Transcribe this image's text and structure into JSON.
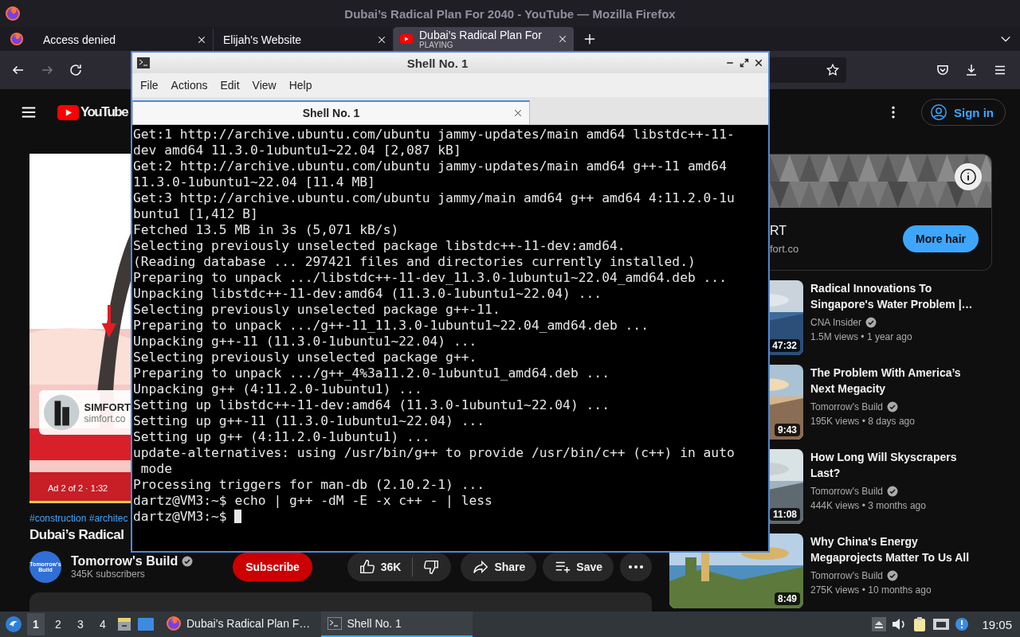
{
  "browser": {
    "title": "Dubai’s Radical Plan For 2040 - YouTube — Mozilla Firefox",
    "tabs": [
      {
        "label": "Access denied",
        "selected": false
      },
      {
        "label": "Elijah's Website",
        "selected": false
      },
      {
        "label": "Dubai’s Radical Plan For",
        "sublabel": "PLAYING",
        "selected": true
      }
    ]
  },
  "page": {
    "header": {
      "logo": "YouTube",
      "sign_in": "Sign in"
    },
    "player": {
      "kind": "picture",
      "ad_card": {
        "name": "SIMFORT",
        "url": "simfort.co"
      },
      "ad_info": "Ad 2 of 2 · 1:32"
    },
    "hashtags": "#construction #architec",
    "title": "Dubai’s Radical",
    "channel": {
      "avatar_text": "Tomorrow's Build",
      "name": "Tomorrow's Build",
      "subscribers": "345K subscribers"
    },
    "subscribe": "Subscribe",
    "likes": "36K",
    "share": "Share",
    "save": "Save"
  },
  "sidebar": {
    "ad": {
      "name": "RT",
      "url": "fort.co",
      "button": "More hair"
    },
    "videos": [
      {
        "title": "Radical Innovations To Singapore's Water Problem |…",
        "channel": "CNA Insider",
        "meta": "1.5M views • 1 year ago",
        "duration": "47:32"
      },
      {
        "title": "The Problem With America’s Next Megacity",
        "channel": "Tomorrow's Build",
        "meta": "195K views • 8 days ago",
        "duration": "9:43"
      },
      {
        "title": "How Long Will Skyscrapers Last?",
        "channel": "Tomorrow's Build",
        "meta": "444K views • 3 months ago",
        "duration": "11:08"
      },
      {
        "title": "Why China's Energy Megaprojects Matter To Us All",
        "channel": "Tomorrow's Build",
        "meta": "275K views • 10 months ago",
        "duration": "8:49"
      }
    ]
  },
  "terminal": {
    "title": "Shell No. 1",
    "menu": [
      "File",
      "Actions",
      "Edit",
      "View",
      "Help"
    ],
    "tabs": [
      {
        "label": "Shell No. 1",
        "selected": true
      }
    ],
    "lines": [
      "Get:1 http://archive.ubuntu.com/ubuntu jammy-updates/main amd64 libstdc++-11-",
      "dev amd64 11.3.0-1ubuntu1~22.04 [2,087 kB]",
      "Get:2 http://archive.ubuntu.com/ubuntu jammy-updates/main amd64 g++-11 amd64",
      "11.3.0-1ubuntu1~22.04 [11.4 MB]",
      "Get:3 http://archive.ubuntu.com/ubuntu jammy/main amd64 g++ amd64 4:11.2.0-1u",
      "buntu1 [1,412 B]",
      "Fetched 13.5 MB in 3s (5,071 kB/s)",
      "Selecting previously unselected package libstdc++-11-dev:amd64.",
      "(Reading database ... 297421 files and directories currently installed.)",
      "Preparing to unpack .../libstdc++-11-dev_11.3.0-1ubuntu1~22.04_amd64.deb ...",
      "Unpacking libstdc++-11-dev:amd64 (11.3.0-1ubuntu1~22.04) ...",
      "Selecting previously unselected package g++-11.",
      "Preparing to unpack .../g++-11_11.3.0-1ubuntu1~22.04_amd64.deb ...",
      "Unpacking g++-11 (11.3.0-1ubuntu1~22.04) ...",
      "Selecting previously unselected package g++.",
      "Preparing to unpack .../g++_4%3a11.2.0-1ubuntu1_amd64.deb ...",
      "Unpacking g++ (4:11.2.0-1ubuntu1) ...",
      "Setting up libstdc++-11-dev:amd64 (11.3.0-1ubuntu1~22.04) ...",
      "Setting up g++-11 (11.3.0-1ubuntu1~22.04) ...",
      "Setting up g++ (4:11.2.0-1ubuntu1) ...",
      "update-alternatives: using /usr/bin/g++ to provide /usr/bin/c++ (c++) in auto",
      " mode",
      "Processing triggers for man-db (2.10.2-1) ...",
      "dartz@VM3:~$ echo | g++ -dM -E -x c++ - | less",
      "dartz@VM3:~$ "
    ]
  },
  "taskbar": {
    "workspaces": [
      {
        "label": "1",
        "selected": true
      },
      {
        "label": "2",
        "selected": false
      },
      {
        "label": "3",
        "selected": false
      },
      {
        "label": "4",
        "selected": false
      }
    ],
    "tasks": [
      {
        "kind": "browser",
        "label": "Dubai’s Radical Plan F…",
        "selected": false
      },
      {
        "kind": "terminal",
        "label": "Shell No. 1",
        "selected": true
      }
    ],
    "clock": "19:05"
  }
}
